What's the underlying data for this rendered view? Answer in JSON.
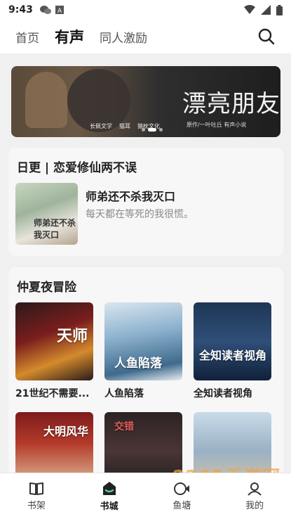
{
  "status_bar": {
    "time": "9:43",
    "left_icons": [
      "wechat-icon",
      "text-a-icon"
    ],
    "right_icons": [
      "wifi-icon",
      "signal-icon",
      "battery-icon"
    ]
  },
  "top_nav": {
    "tabs": [
      {
        "label": "首页",
        "active": false
      },
      {
        "label": "有声",
        "active": true
      },
      {
        "label": "同人激励",
        "active": false
      }
    ],
    "search_icon": "search-icon"
  },
  "banner": {
    "title": "漂亮朋友",
    "author_caption": "原作/一叶吐丘",
    "brand_caption": "有声小说",
    "publishers": [
      "长佩文学",
      "猫耳",
      "猿枕文化"
    ],
    "slide_count": 3,
    "active_slide": 1
  },
  "daily_section": {
    "header": "日更 | 恋爱修仙两不误",
    "book": {
      "title": "师弟还不杀我灭口",
      "subtitle": "每天都在等死的我很慌。",
      "cover_text": "师弟还不杀我灭口"
    }
  },
  "summer_section": {
    "header": "仲夏夜冒险",
    "books": [
      {
        "title": "21世纪不需要...",
        "cover_text": "天师"
      },
      {
        "title": "人鱼陷落",
        "cover_text": "人鱼陷落"
      },
      {
        "title": "全知读者视角",
        "cover_text": "全知读者视角"
      },
      {
        "title": "",
        "cover_text": "大明风华"
      },
      {
        "title": "",
        "cover_text": "交错"
      },
      {
        "title": "",
        "cover_text": ""
      }
    ]
  },
  "bottom_nav": {
    "items": [
      {
        "label": "书架",
        "icon": "book-icon",
        "active": false
      },
      {
        "label": "书城",
        "icon": "store-icon",
        "active": true
      },
      {
        "label": "鱼塘",
        "icon": "fish-icon",
        "active": false
      },
      {
        "label": "我的",
        "icon": "profile-icon",
        "active": false
      }
    ]
  },
  "watermark": "2265手游网"
}
